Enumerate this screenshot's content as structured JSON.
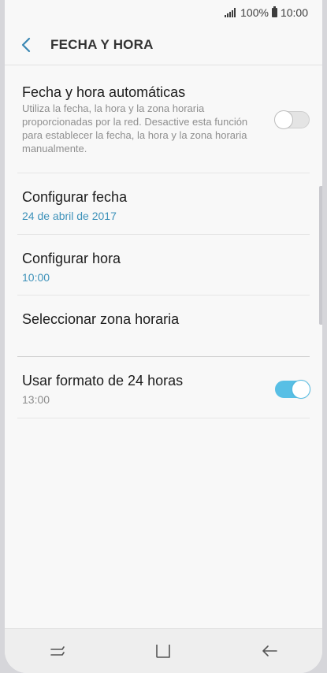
{
  "status_bar": {
    "battery": "100%",
    "time": "10:00"
  },
  "header": {
    "title": "FECHA Y HORA",
    "back_icon": "chevron-left-icon"
  },
  "settings": {
    "auto": {
      "title": "Fecha y hora automáticas",
      "description": "Utiliza la fecha, la hora y la zona horaria proporcionadas por la red. Desactive esta función para establecer la fecha, la hora y la zona horaria manualmente.",
      "enabled": false
    },
    "date": {
      "title": "Configurar fecha",
      "value": "24 de abril de 2017"
    },
    "time": {
      "title": "Configurar hora",
      "value": "10:00"
    },
    "timezone": {
      "title": "Seleccionar zona horaria"
    },
    "format24": {
      "title": "Usar formato de 24 horas",
      "value": "13:00",
      "enabled": true
    }
  },
  "colors": {
    "accent": "#58bfe5",
    "value_blue": "#3e92ba",
    "background": "#f8f8f8"
  },
  "nav_bar": {
    "buttons": [
      "recent-apps-icon",
      "home-icon",
      "back-arrow-icon"
    ]
  }
}
